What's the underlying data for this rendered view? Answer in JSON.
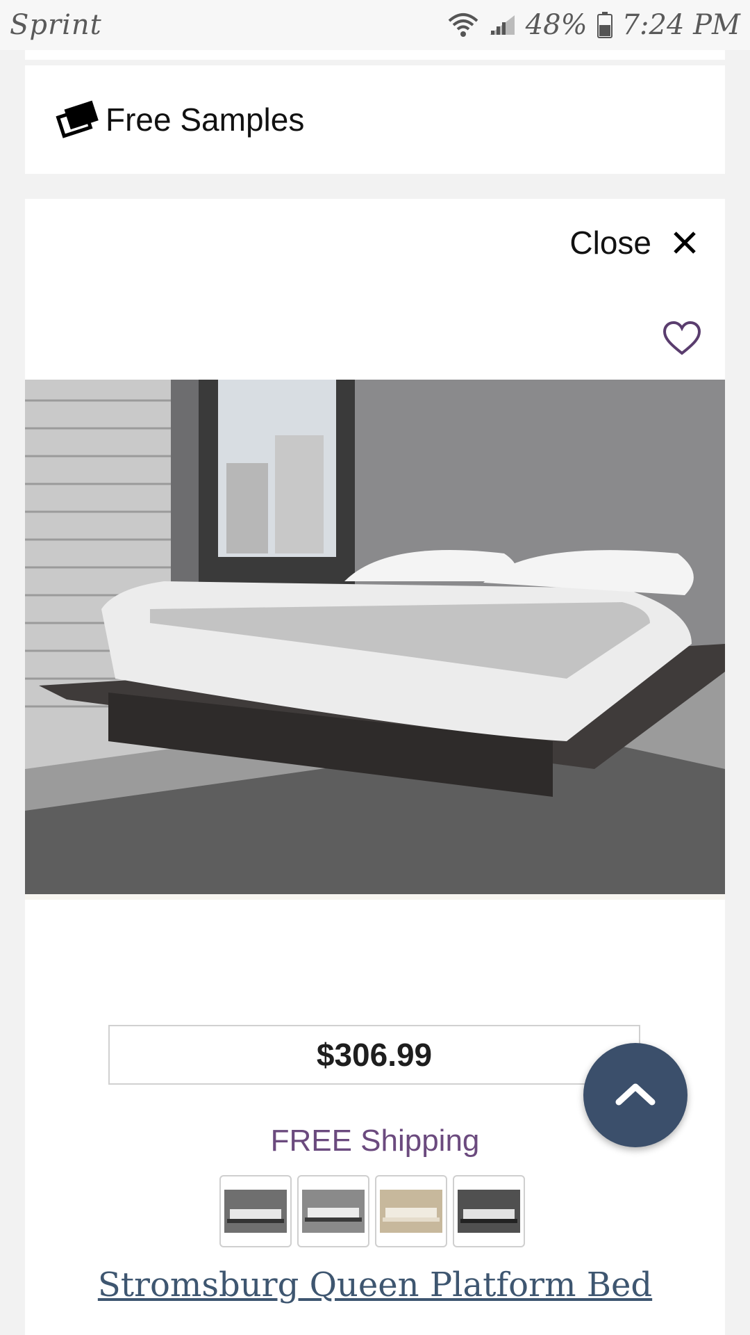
{
  "status_bar": {
    "carrier": "Sprint",
    "battery": "48%",
    "time": "7:24 PM",
    "icons": [
      "wifi-icon",
      "signal-icon",
      "battery-icon"
    ]
  },
  "samples": {
    "label": "Free Samples",
    "icon": "swatch-icon"
  },
  "quickview": {
    "close_label": "Close",
    "close_icon": "close-icon",
    "favorite_icon": "heart-icon"
  },
  "product": {
    "image_alt": "bed-photo",
    "price": "$306.99",
    "shipping": "FREE Shipping",
    "title": "Stromsburg Queen Platform Bed",
    "thumbnails": [
      "thumbnail-1",
      "thumbnail-2",
      "thumbnail-3",
      "thumbnail-4"
    ]
  },
  "colors": {
    "accent_purple": "#6b4a7e",
    "title_link": "#3e5670",
    "scroll_button": "#3b4f6b"
  },
  "scroll_top_icon": "chevron-up-icon"
}
